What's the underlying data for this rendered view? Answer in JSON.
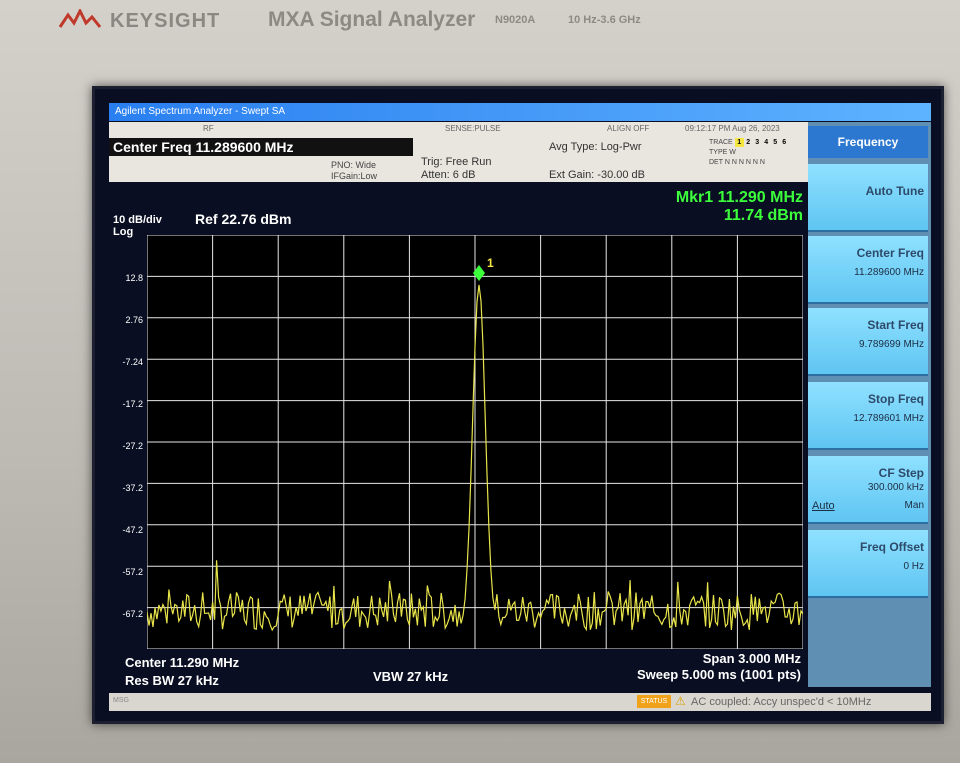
{
  "bezel": {
    "brand": "KEYSIGHT",
    "model_title": "MXA Signal Analyzer",
    "model_number": "N9020A",
    "freq_range": "10 Hz-3.6 GHz"
  },
  "window": {
    "title": "Agilent Spectrum Analyzer - Swept SA"
  },
  "status_row": {
    "rf": "RF",
    "sense": "SENSE:PULSE",
    "align": "ALIGN OFF",
    "timestamp": "09:12:17 PM Aug 26, 2023"
  },
  "header": {
    "center_freq": "Center Freq 11.289600 MHz",
    "pno": "PNO: Wide",
    "ifgain": "IFGain:Low",
    "trig": "Trig: Free Run",
    "atten": "Atten: 6 dB",
    "avg_type": "Avg Type: Log-Pwr",
    "ext_gain": "Ext Gain: -30.00 dB",
    "trace_label": "TRACE",
    "type_label": "TYPE",
    "det_label": "DET",
    "trace_nums": [
      "1",
      "2",
      "3",
      "4",
      "5",
      "6"
    ],
    "type_vals": "W",
    "det_vals": "N N N N N N"
  },
  "marker": {
    "freq": "Mkr1 11.290 MHz",
    "amp": "11.74 dBm",
    "id": "1"
  },
  "scale": {
    "div": "10 dB/div",
    "ref": "Ref 22.76 dBm",
    "log": "Log",
    "y_labels": [
      "12.8",
      "2.76",
      "-7.24",
      "-17.2",
      "-27.2",
      "-37.2",
      "-47.2",
      "-57.2",
      "-67.2"
    ]
  },
  "footer": {
    "center": "Center 11.290 MHz",
    "res_bw": "Res BW 27 kHz",
    "vbw": "VBW 27 kHz",
    "span": "Span 3.000 MHz",
    "sweep": "Sweep 5.000 ms (1001 pts)"
  },
  "msgbar": {
    "msg": "MSG",
    "status": "STATUS",
    "status_text": "AC coupled: Accy unspec'd < 10MHz"
  },
  "softkeys": {
    "title": "Frequency",
    "auto_tune": "Auto Tune",
    "center_freq_label": "Center Freq",
    "center_freq_val": "11.289600 MHz",
    "start_freq_label": "Start Freq",
    "start_freq_val": "9.789699 MHz",
    "stop_freq_label": "Stop Freq",
    "stop_freq_val": "12.789601 MHz",
    "cf_step_label": "CF Step",
    "cf_step_val": "300.000 kHz",
    "cf_step_auto": "Auto",
    "cf_step_man": "Man",
    "freq_offset_label": "Freq Offset",
    "freq_offset_val": "0 Hz"
  },
  "colors": {
    "trace": "#e8e44a",
    "marker_text": "#3cff3c",
    "grid": "#e6e6e6",
    "screen_bg": "#0a0e22"
  }
}
